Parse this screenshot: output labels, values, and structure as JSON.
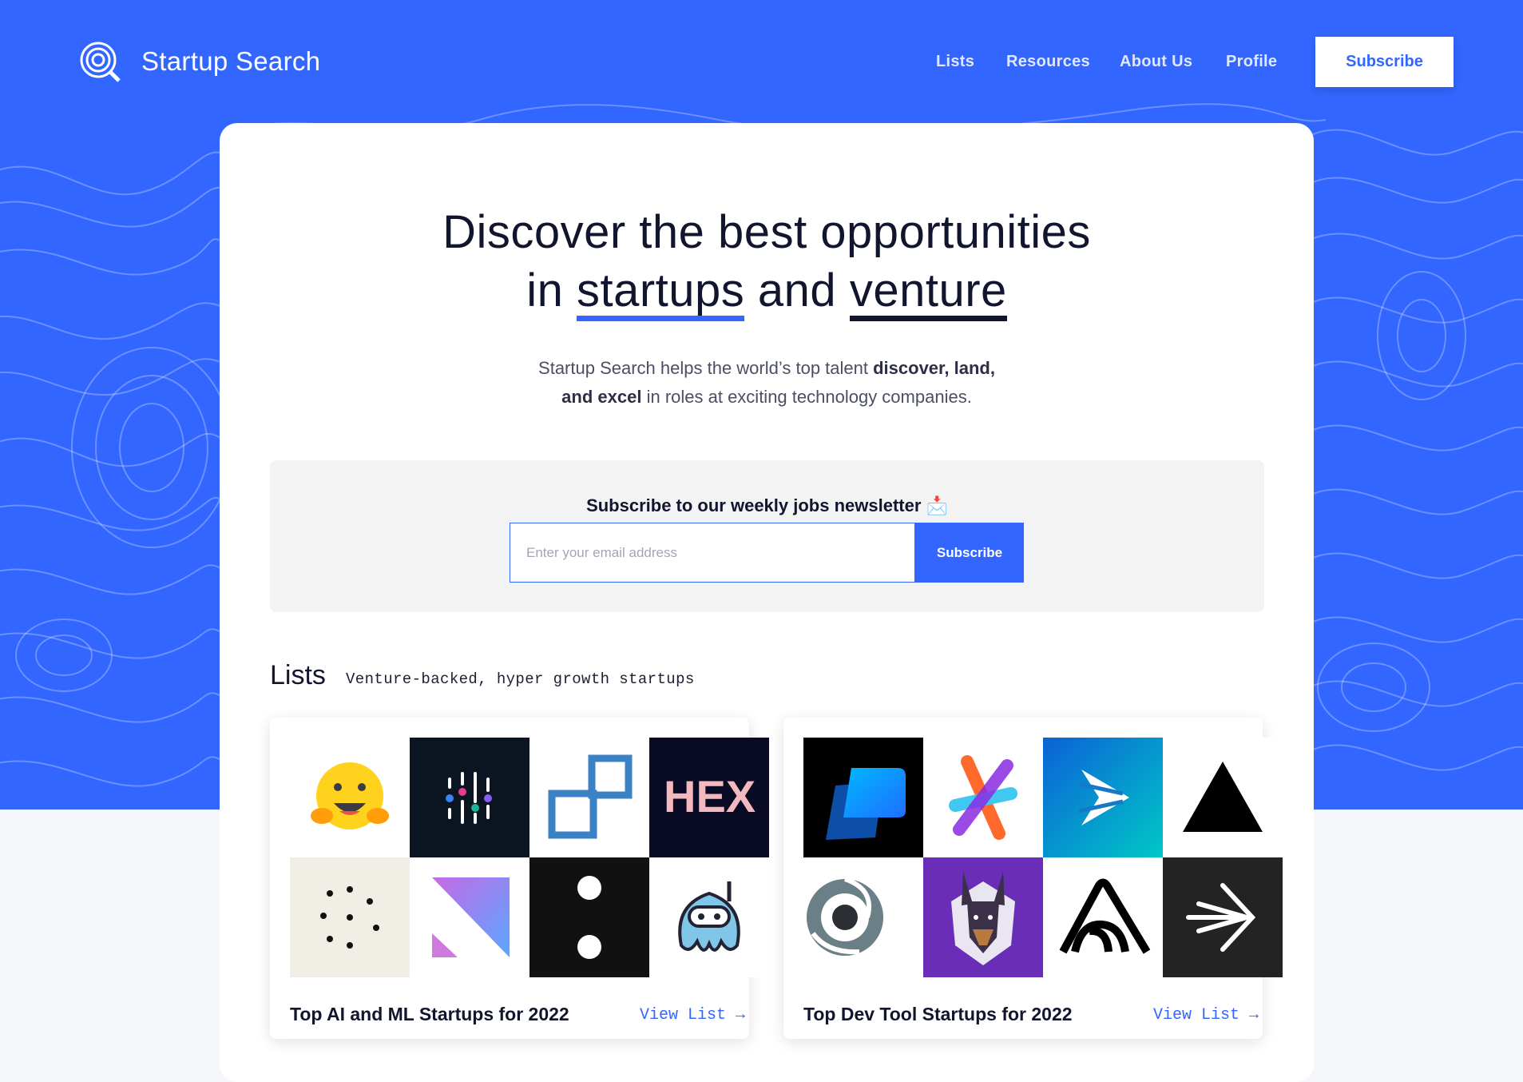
{
  "header": {
    "brand": "Startup Search",
    "nav": [
      "Lists",
      "Resources",
      "About Us",
      "Profile"
    ],
    "subscribe_label": "Subscribe"
  },
  "hero": {
    "line1": "Discover the best opportunities",
    "line2_pre": "in",
    "line2_word1": "startups",
    "line2_mid": "and",
    "line2_word2": "venture",
    "sub_1": "Startup Search helps the world’s top talent",
    "sub_bold_1": "discover, land,",
    "sub_bold_2": "and excel",
    "sub_2": "in roles at exciting technology companies."
  },
  "newsletter": {
    "title": "Subscribe to our weekly jobs newsletter",
    "emoji": "📩",
    "placeholder": "Enter your email address",
    "button": "Subscribe"
  },
  "lists": {
    "title": "Lists",
    "subtitle": "Venture-backed, hyper growth startups",
    "cards": [
      {
        "name": "Top AI and ML Startups for 2022",
        "link": "View List →",
        "logos": [
          "hugging-face-logo",
          "weights-biases-logo",
          "hyperplane-logo",
          "hex-logo",
          "dots-logo",
          "gradient-logo",
          "colon-logo",
          "octopus-logo"
        ],
        "hex_text": "HEX"
      },
      {
        "name": "Top Dev Tool Startups for 2022",
        "link": "View List →",
        "logos": [
          "blue-shape-logo",
          "x-cross-logo",
          "arrow-triangle-logo",
          "vercel-triangle-logo",
          "aperture-logo",
          "doberman-logo",
          "sentry-logo",
          "arrow-burst-logo"
        ]
      }
    ]
  },
  "colors": {
    "brand": "#3366ff",
    "ink": "#12152e"
  }
}
